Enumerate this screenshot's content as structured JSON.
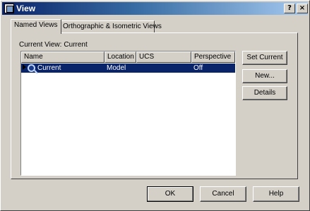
{
  "window": {
    "title": "View",
    "help_glyph": "?",
    "close_glyph": "×"
  },
  "tabs": [
    {
      "label": "Named Views"
    },
    {
      "label": "Orthographic & Isometric Views"
    }
  ],
  "current_view": {
    "label": "Current View:",
    "value": "Current"
  },
  "list": {
    "columns": [
      "Name",
      "Location",
      "UCS",
      "Perspective"
    ],
    "rows": [
      {
        "name": "Current",
        "location": "Model",
        "ucs": "",
        "perspective": "Off",
        "selected": true
      }
    ]
  },
  "side_buttons": {
    "set_current": "Set Current",
    "new": "New...",
    "details": "Details"
  },
  "footer_buttons": {
    "ok": "OK",
    "cancel": "Cancel",
    "help": "Help"
  },
  "colors": {
    "selection": "#0a246a",
    "title_gradient_start": "#0a246a",
    "title_gradient_end": "#a6caf0",
    "face": "#d4d0c8"
  }
}
